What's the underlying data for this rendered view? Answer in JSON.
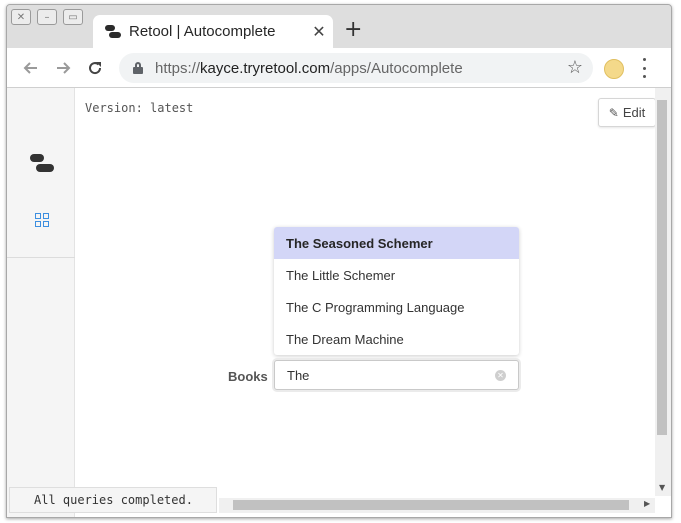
{
  "browser": {
    "tab_title": "Retool | Autocomplete",
    "tab_close": "✕",
    "new_tab": "+",
    "url_scheme": "https://",
    "url_host": "kayce.tryretool.com",
    "url_path": "/apps/Autocomplete"
  },
  "app": {
    "version_text": "Version: latest",
    "edit_label": "Edit",
    "status_text": "All queries completed."
  },
  "autocomplete": {
    "label": "Books",
    "value": "The",
    "options": [
      "The Seasoned Schemer",
      "The Little Schemer",
      "The C Programming Language",
      "The Dream Machine"
    ],
    "highlighted_index": 0
  },
  "colors": {
    "highlight": "#d3d6f7",
    "accent_grid": "#3d8fe0"
  }
}
